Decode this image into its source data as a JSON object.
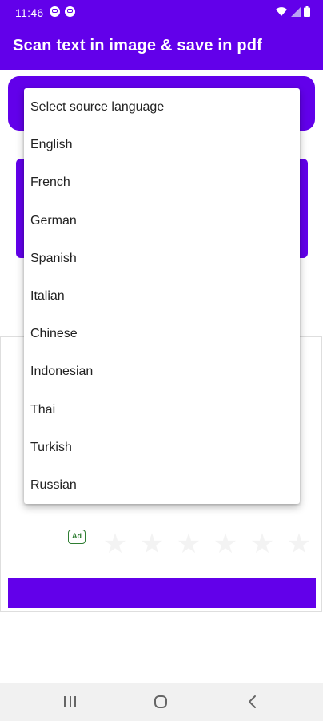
{
  "status_bar": {
    "time": "11:46"
  },
  "app_bar": {
    "title": "Scan text in image & save in pdf"
  },
  "dropdown": {
    "items": [
      "Select source language",
      "English",
      "French",
      "German",
      "Spanish",
      "Italian",
      "Chinese",
      "Indonesian",
      "Thai",
      "Turkish",
      "Russian"
    ]
  },
  "ad": {
    "badge": "Ad"
  },
  "colors": {
    "primary": "#6200ea",
    "ad_green": "#2e7d32"
  },
  "icons": {
    "status": [
      "notification-icon",
      "notification-icon",
      "wifi-icon",
      "signal-icon",
      "battery-icon"
    ],
    "nav": [
      "recents-icon",
      "home-icon",
      "back-icon"
    ]
  }
}
